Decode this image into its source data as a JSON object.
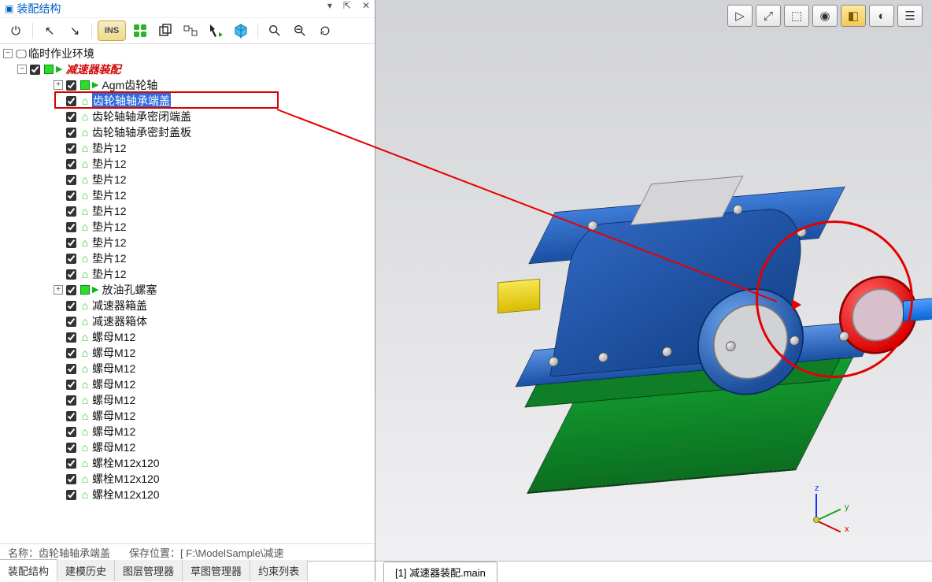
{
  "panel": {
    "title": "装配结构",
    "ctrls": {
      "min": "▾",
      "pin": "⇱",
      "close": "✕"
    }
  },
  "toolbar": {
    "ins_label": "INS"
  },
  "tree": {
    "root": {
      "label": "临时作业环境"
    },
    "assembly": {
      "label": "减速器装配"
    },
    "items": [
      {
        "label": "Agm齿轮轴",
        "icon": "asm",
        "exp": "+",
        "indent": 3
      },
      {
        "label": "齿轮轴轴承端盖",
        "icon": "part",
        "indent": 3,
        "selected": true
      },
      {
        "label": "齿轮轴轴承密闭端盖",
        "icon": "part",
        "indent": 3
      },
      {
        "label": "齿轮轴轴承密封盖板",
        "icon": "part",
        "indent": 3
      },
      {
        "label": "垫片12",
        "icon": "part",
        "indent": 3
      },
      {
        "label": "垫片12",
        "icon": "part",
        "indent": 3
      },
      {
        "label": "垫片12",
        "icon": "part",
        "indent": 3
      },
      {
        "label": "垫片12",
        "icon": "part",
        "indent": 3
      },
      {
        "label": "垫片12",
        "icon": "part",
        "indent": 3
      },
      {
        "label": "垫片12",
        "icon": "part",
        "indent": 3
      },
      {
        "label": "垫片12",
        "icon": "part",
        "indent": 3
      },
      {
        "label": "垫片12",
        "icon": "part",
        "indent": 3
      },
      {
        "label": "垫片12",
        "icon": "part",
        "indent": 3
      },
      {
        "label": "放油孔螺塞",
        "icon": "asm",
        "exp": "+",
        "indent": 3
      },
      {
        "label": "减速器箱盖",
        "icon": "part",
        "indent": 3
      },
      {
        "label": "减速器箱体",
        "icon": "part",
        "indent": 3
      },
      {
        "label": "螺母M12",
        "icon": "part",
        "indent": 3
      },
      {
        "label": "螺母M12",
        "icon": "part",
        "indent": 3
      },
      {
        "label": "螺母M12",
        "icon": "part",
        "indent": 3
      },
      {
        "label": "螺母M12",
        "icon": "part",
        "indent": 3
      },
      {
        "label": "螺母M12",
        "icon": "part",
        "indent": 3
      },
      {
        "label": "螺母M12",
        "icon": "part",
        "indent": 3
      },
      {
        "label": "螺母M12",
        "icon": "part",
        "indent": 3
      },
      {
        "label": "螺母M12",
        "icon": "part",
        "indent": 3
      },
      {
        "label": "螺栓M12x120",
        "icon": "part",
        "indent": 3
      },
      {
        "label": "螺栓M12x120",
        "icon": "part",
        "indent": 3
      },
      {
        "label": "螺栓M12x120",
        "icon": "part",
        "indent": 3
      }
    ]
  },
  "status": {
    "name_label": "名称：",
    "name_value": "齿轮轴轴承端盖",
    "path_label": "保存位置：",
    "path_value": "[ F:\\ModelSample\\减速"
  },
  "tabs": {
    "t0": "装配结构",
    "t1": "建模历史",
    "t2": "图层管理器",
    "t3": "草图管理器",
    "t4": "约束列表"
  },
  "viewport": {
    "doc_tab": "[1] 减速器装配.main",
    "axes": {
      "x": "x",
      "y": "y",
      "z": "z"
    }
  }
}
